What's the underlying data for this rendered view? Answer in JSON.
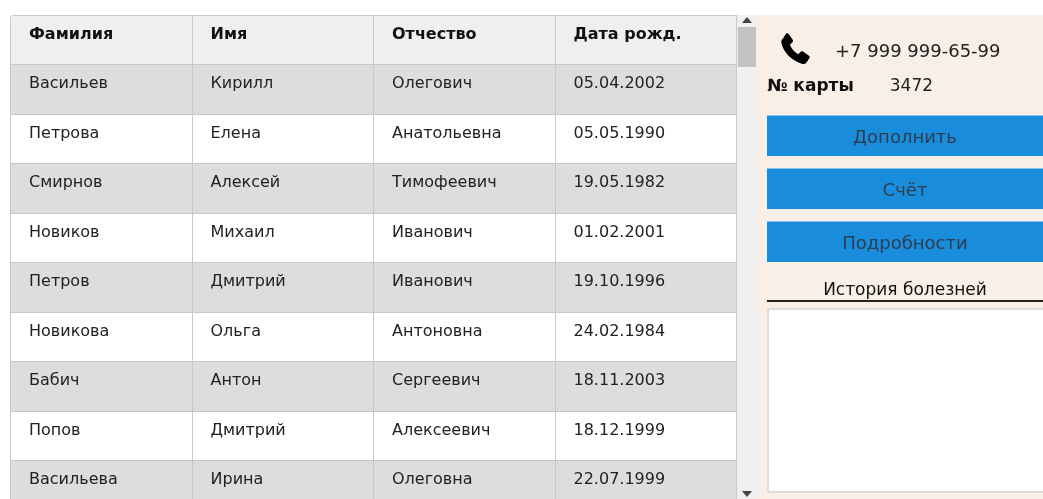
{
  "table": {
    "columns": [
      "Фамилия",
      "Имя",
      "Отчество",
      "Дата рожд."
    ],
    "rows": [
      [
        "Васильев",
        "Кирилл",
        "Олегович",
        "05.04.2002"
      ],
      [
        "Петрова",
        "Елена",
        "Анатольевна",
        "05.05.1990"
      ],
      [
        "Смирнов",
        "Алексей",
        "Тимофеевич",
        "19.05.1982"
      ],
      [
        "Новиков",
        "Михаил",
        "Иванович",
        "01.02.2001"
      ],
      [
        "Петров",
        "Дмитрий",
        "Иванович",
        "19.10.1996"
      ],
      [
        "Новикова",
        "Ольга",
        "Антоновна",
        "24.02.1984"
      ],
      [
        "Бабич",
        "Антон",
        "Сергеевич",
        "18.11.2003"
      ],
      [
        "Попов",
        "Дмитрий",
        "Алексеевич",
        "18.12.1999"
      ],
      [
        "Васильева",
        "Ирина",
        "Олеговна",
        "22.07.1999"
      ]
    ]
  },
  "panel": {
    "phone": "+7 999 999-65-99",
    "card_label": "№ карты",
    "card_number": "3472",
    "buttons": [
      "Дополнить",
      "Счёт",
      "Подробности"
    ],
    "history_label": "История болезней"
  }
}
